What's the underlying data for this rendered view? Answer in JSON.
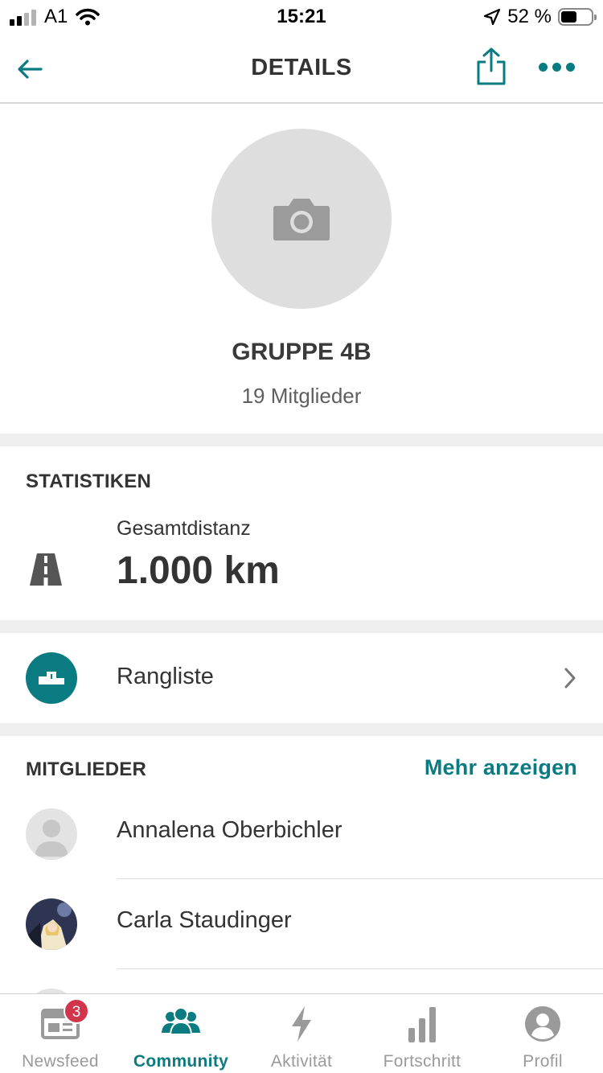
{
  "status_bar": {
    "carrier": "A1",
    "time": "15:21",
    "battery": "52 %"
  },
  "header": {
    "title": "DETAILS"
  },
  "group": {
    "name": "GRUPPE 4B",
    "member_count": "19 Mitglieder"
  },
  "stats": {
    "heading": "STATISTIKEN",
    "label": "Gesamtdistanz",
    "value": "1.000 km"
  },
  "leaderboard": {
    "label": "Rangliste"
  },
  "members": {
    "heading": "MITGLIEDER",
    "more_label": "Mehr anzeigen",
    "items": [
      {
        "name": "Annalena Oberbichler",
        "avatar": "placeholder"
      },
      {
        "name": "Carla Staudinger",
        "avatar": "photo"
      }
    ]
  },
  "tabbar": {
    "items": [
      {
        "label": "Newsfeed",
        "icon": "newsfeed-icon",
        "badge": "3"
      },
      {
        "label": "Community",
        "icon": "community-icon"
      },
      {
        "label": "Aktivität",
        "icon": "lightning-icon"
      },
      {
        "label": "Fortschritt",
        "icon": "bar-chart-icon"
      },
      {
        "label": "Profil",
        "icon": "profile-icon"
      }
    ],
    "active": "Community"
  },
  "colors": {
    "accent": "#0a7b80",
    "badge": "#d2344a",
    "text": "#333333",
    "muted": "#9a9a9a"
  }
}
